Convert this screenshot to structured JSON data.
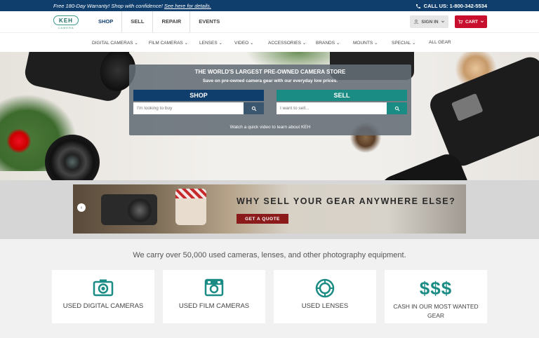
{
  "topbar": {
    "promo_prefix": "Free 180-Day Warranty! Shop with confidence! ",
    "promo_link": "See here for details.",
    "call_label": "CALL US: 1-800-342-5534"
  },
  "header": {
    "logo_text": "KEH",
    "logo_sub": "CAMERA",
    "nav": [
      "SHOP",
      "SELL",
      "REPAIR",
      "EVENTS"
    ],
    "signin": "SIGN IN",
    "cart": "CART"
  },
  "categories": [
    "DIGITAL CAMERAS",
    "FILM CAMERAS",
    "LENSES",
    "VIDEO",
    "ACCESSORIES",
    "BRANDS",
    "MOUNTS",
    "SPECIAL",
    "ALL GEAR"
  ],
  "hero": {
    "title": "THE WORLD'S LARGEST PRE-OWNED CAMERA STORE",
    "subtitle": "Save on pre-owned camera gear with our everyday low prices.",
    "shop_label": "SHOP",
    "shop_placeholder": "I'm looking to buy",
    "sell_label": "SELL",
    "sell_placeholder": "I want to sell...",
    "video_text": "Watch a quick video to learn about KEH"
  },
  "banner": {
    "headline": "WHY SELL YOUR GEAR ANYWHERE ELSE?",
    "button": "GET A QUOTE",
    "prev_arrow": "‹"
  },
  "bottom": {
    "tagline": "We carry over 50,000 used cameras, lenses, and other photography equipment.",
    "cards": [
      {
        "label": "USED DIGITAL CAMERAS",
        "icon": "digital-camera-icon"
      },
      {
        "label": "USED FILM CAMERAS",
        "icon": "film-camera-icon"
      },
      {
        "label": "USED LENSES",
        "icon": "lens-icon"
      },
      {
        "label": "CASH IN OUR MOST WANTED GEAR",
        "icon": "dollar-icon",
        "icon_text": "$$$"
      }
    ]
  },
  "colors": {
    "navy": "#0f3e6d",
    "teal": "#1b8c84",
    "red": "#c8102e",
    "quote_red": "#8b1a1a"
  }
}
